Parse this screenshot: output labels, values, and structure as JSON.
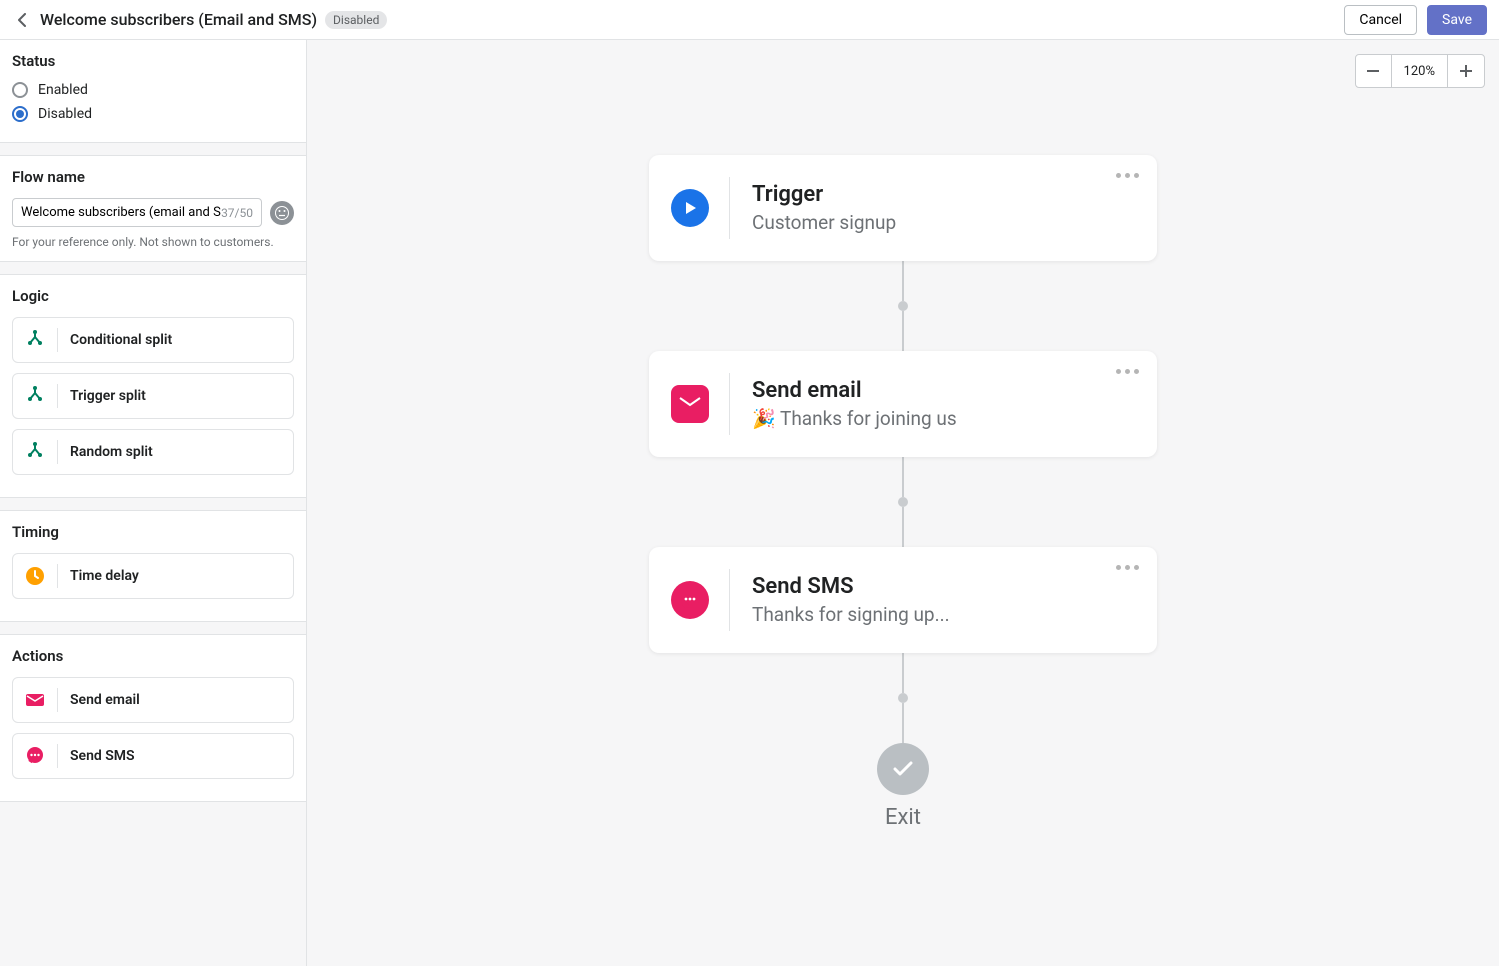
{
  "header": {
    "title": "Welcome subscribers (Email and SMS)",
    "badge": "Disabled",
    "cancel": "Cancel",
    "save": "Save"
  },
  "sidebar": {
    "status": {
      "title": "Status",
      "options": [
        {
          "label": "Enabled",
          "selected": false
        },
        {
          "label": "Disabled",
          "selected": true
        }
      ]
    },
    "flowname": {
      "title": "Flow name",
      "value": "Welcome subscribers (email and SMS",
      "charcount": "37/50",
      "helper": "For your reference only. Not shown to customers."
    },
    "logic": {
      "title": "Logic",
      "items": [
        {
          "label": "Conditional split",
          "icon": "split",
          "color": "#008060"
        },
        {
          "label": "Trigger split",
          "icon": "split",
          "color": "#008060"
        },
        {
          "label": "Random split",
          "icon": "split",
          "color": "#008060"
        }
      ]
    },
    "timing": {
      "title": "Timing",
      "items": [
        {
          "label": "Time delay",
          "icon": "clock",
          "color": "#ffa000"
        }
      ]
    },
    "actions": {
      "title": "Actions",
      "items": [
        {
          "label": "Send email",
          "icon": "email",
          "color": "#e91e63"
        },
        {
          "label": "Send SMS",
          "icon": "sms",
          "color": "#e91e63"
        }
      ]
    }
  },
  "zoom": {
    "value": "120%"
  },
  "flow": {
    "nodes": [
      {
        "title": "Trigger",
        "subtitle": "Customer signup",
        "icon": "play",
        "color": "#1a73e8"
      },
      {
        "title": "Send email",
        "subtitle": "🎉 Thanks for joining us",
        "icon": "email",
        "color": "#e91e63"
      },
      {
        "title": "Send SMS",
        "subtitle": "Thanks for signing up...",
        "icon": "sms",
        "color": "#e91e63"
      }
    ],
    "exit": "Exit"
  }
}
